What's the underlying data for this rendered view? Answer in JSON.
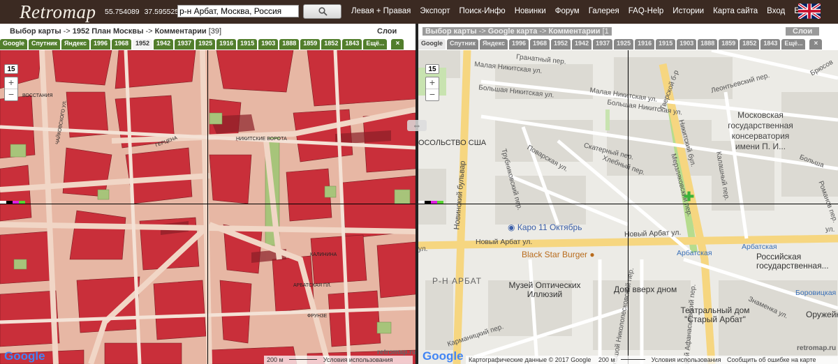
{
  "header": {
    "logo": "Retromap",
    "latitude": "55.754089",
    "longitude": "37.595525",
    "search_value": "р-н Арбат, Москва, Россия",
    "menu": [
      "Левая + Правая",
      "Экспорт",
      "Поиск-Инфо",
      "Новинки",
      "Форум",
      "Галерея",
      "FAQ-Help",
      "Истории",
      "Карта сайта",
      "Вход",
      "Ещё..."
    ]
  },
  "left_pane": {
    "crumb_map_select": "Выбор карты",
    "crumb_map": "1952 План Москвы",
    "crumb_comments": "Комментарии",
    "crumb_comments_count": "[39]",
    "layers": "Слои",
    "tabs": [
      "Google",
      "Спутник",
      "Яндекс",
      "1996",
      "1968",
      "1952",
      "1942",
      "1937",
      "1925",
      "1916",
      "1915",
      "1903",
      "1888",
      "1859",
      "1852",
      "1843",
      "Ещё..."
    ],
    "active_tab": "1952",
    "close": "×",
    "zoom": "15",
    "zoom_in": "+",
    "zoom_out": "−",
    "google": "Google",
    "watermark": "retromap.ru",
    "scale": "200 м",
    "terms": "Условия использования",
    "map_labels": [
      "ВОССТАНИЯ",
      "ЧАЙКОВСКОГО УЛ.",
      "НИКИТСКИЕ ВОРОТА",
      "ГЕРЦЕНА",
      "КАЛИНИНА",
      "АРБАТСКАЯ ПЛ.",
      "ФРУНЗЕ"
    ]
  },
  "right_pane": {
    "crumb_map_select": "Выбор карты",
    "crumb_map": "Google карта",
    "crumb_comments": "Комментарии",
    "crumb_comments_count": "[1",
    "layers": "Слои",
    "tabs": [
      "Google",
      "Спутник",
      "Яндекс",
      "1996",
      "1968",
      "1952",
      "1942",
      "1937",
      "1925",
      "1916",
      "1915",
      "1903",
      "1888",
      "1859",
      "1852",
      "1843",
      "Ещё..."
    ],
    "active_tab": "Google",
    "close": "×",
    "zoom": "15",
    "zoom_in": "+",
    "zoom_out": "−",
    "google": "Google",
    "watermark": "retromap.ru",
    "map_data": "Картографические данные © 2017 Google",
    "scale": "200 м",
    "terms": "Условия использования",
    "report": "Сообщить об ошибке на карте",
    "labels": {
      "malaya_nikitskaya": "Малая Никитская ул.",
      "bolshaya_nikitskaya": "Большая Никитская ул.",
      "bolshaya_nikitskaya2": "Большая Никитская ул.",
      "malaya_nikitskaya2": "Малая Никитская ул.",
      "granatny": "Гранатный пер.",
      "usa": "ОСОЛЬСТВО США",
      "novinsky": "Новинский бульвар",
      "trubnikovsky": "Трубниковский пер.",
      "povarskaya": "Поварская ул.",
      "skaterny": "Скатерный пер.",
      "khlebny": "Хлебный пер.",
      "merzlyakovsky": "Мерзляковский пер.",
      "nikitsky_blvd": "Никитский бул.",
      "kalashny": "Калашный пер.",
      "tverskoy": "Тверской б-р",
      "leontyevsky": "Леонтьевский пер.",
      "bryusov": "Брюсов",
      "conservatory": "Московская государственная консерватория имени П. И...",
      "bolshaya_right": "Больша",
      "romanov": "Романов пер.",
      "karo": "Каро 11 Октябрь",
      "novy_arbat": "Новый Арбат ул.",
      "novy_arbat2": "Новый Арбат ул.",
      "novy_arbat3": "Новый Арбат ул.",
      "black_star": "Black Star Burger",
      "rn_arbat": "Р-Н АРБАТ",
      "museum_optics": "Музей Оптических Иллюзий",
      "dom_vverkh": "Дом вверх дном",
      "arbatskaya_m": "Арбатская",
      "arbatskaya_m2": "Арбатская",
      "rgb": "Российская государственная...",
      "borovitskaya": "Боровицкая",
      "teatr": "Театральный дом \"Старый Арбат\"",
      "znamenka": "Знаменка ул.",
      "oruzhe": "Оружейный",
      "karmanitsky": "Карманицкий пер.",
      "bolshoy_nikolopeskovsky": "Большой Николопесковский пер.",
      "bolshoy_afanasyevsky": "Большой Афанасьевский пер.",
      "ul": "ул.",
      "u": "ул."
    }
  },
  "colors": {
    "topbar": "#3b2a22",
    "tab_green": "#527e2c",
    "tab_grey": "#888888",
    "old_map_red": "#c8323a",
    "old_map_pink": "#e9b8a8"
  }
}
